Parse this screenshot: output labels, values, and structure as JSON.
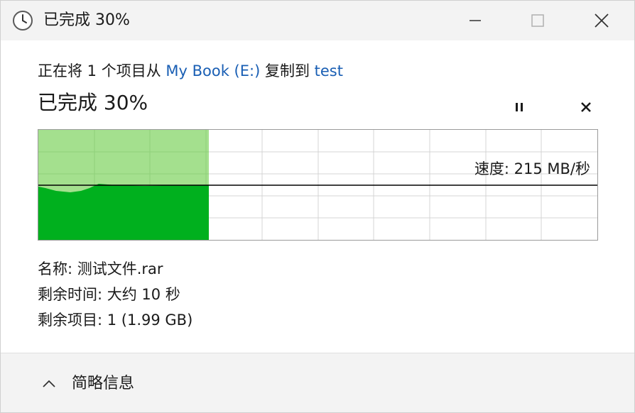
{
  "window": {
    "title": "已完成 30%",
    "icon": "clock-icon",
    "controls": [
      "minimize-icon",
      "maximize-icon",
      "close-icon"
    ]
  },
  "copy": {
    "prefix": "正在将 1 个项目从 ",
    "source": "My Book (E:)",
    "middle": " 复制到 ",
    "destination": "test"
  },
  "progress": {
    "title": "已完成 30%",
    "percent": 30,
    "pause_icon": "pause-icon",
    "cancel_icon": "cancel-icon"
  },
  "speed": {
    "label": "速度: 215 MB/秒"
  },
  "details": {
    "name": "名称: 测试文件.rar",
    "time_remaining": "剩余时间: 大约 10 秒",
    "items_remaining": "剩余项目: 1 (1.99 GB)"
  },
  "footer": {
    "toggle_label": "简略信息",
    "toggle_icon": "chevron-up-icon"
  },
  "colors": {
    "graph_fill": "#00b01e",
    "graph_progress_bg": "#a4e08e",
    "link": "#1a5fb4"
  }
}
